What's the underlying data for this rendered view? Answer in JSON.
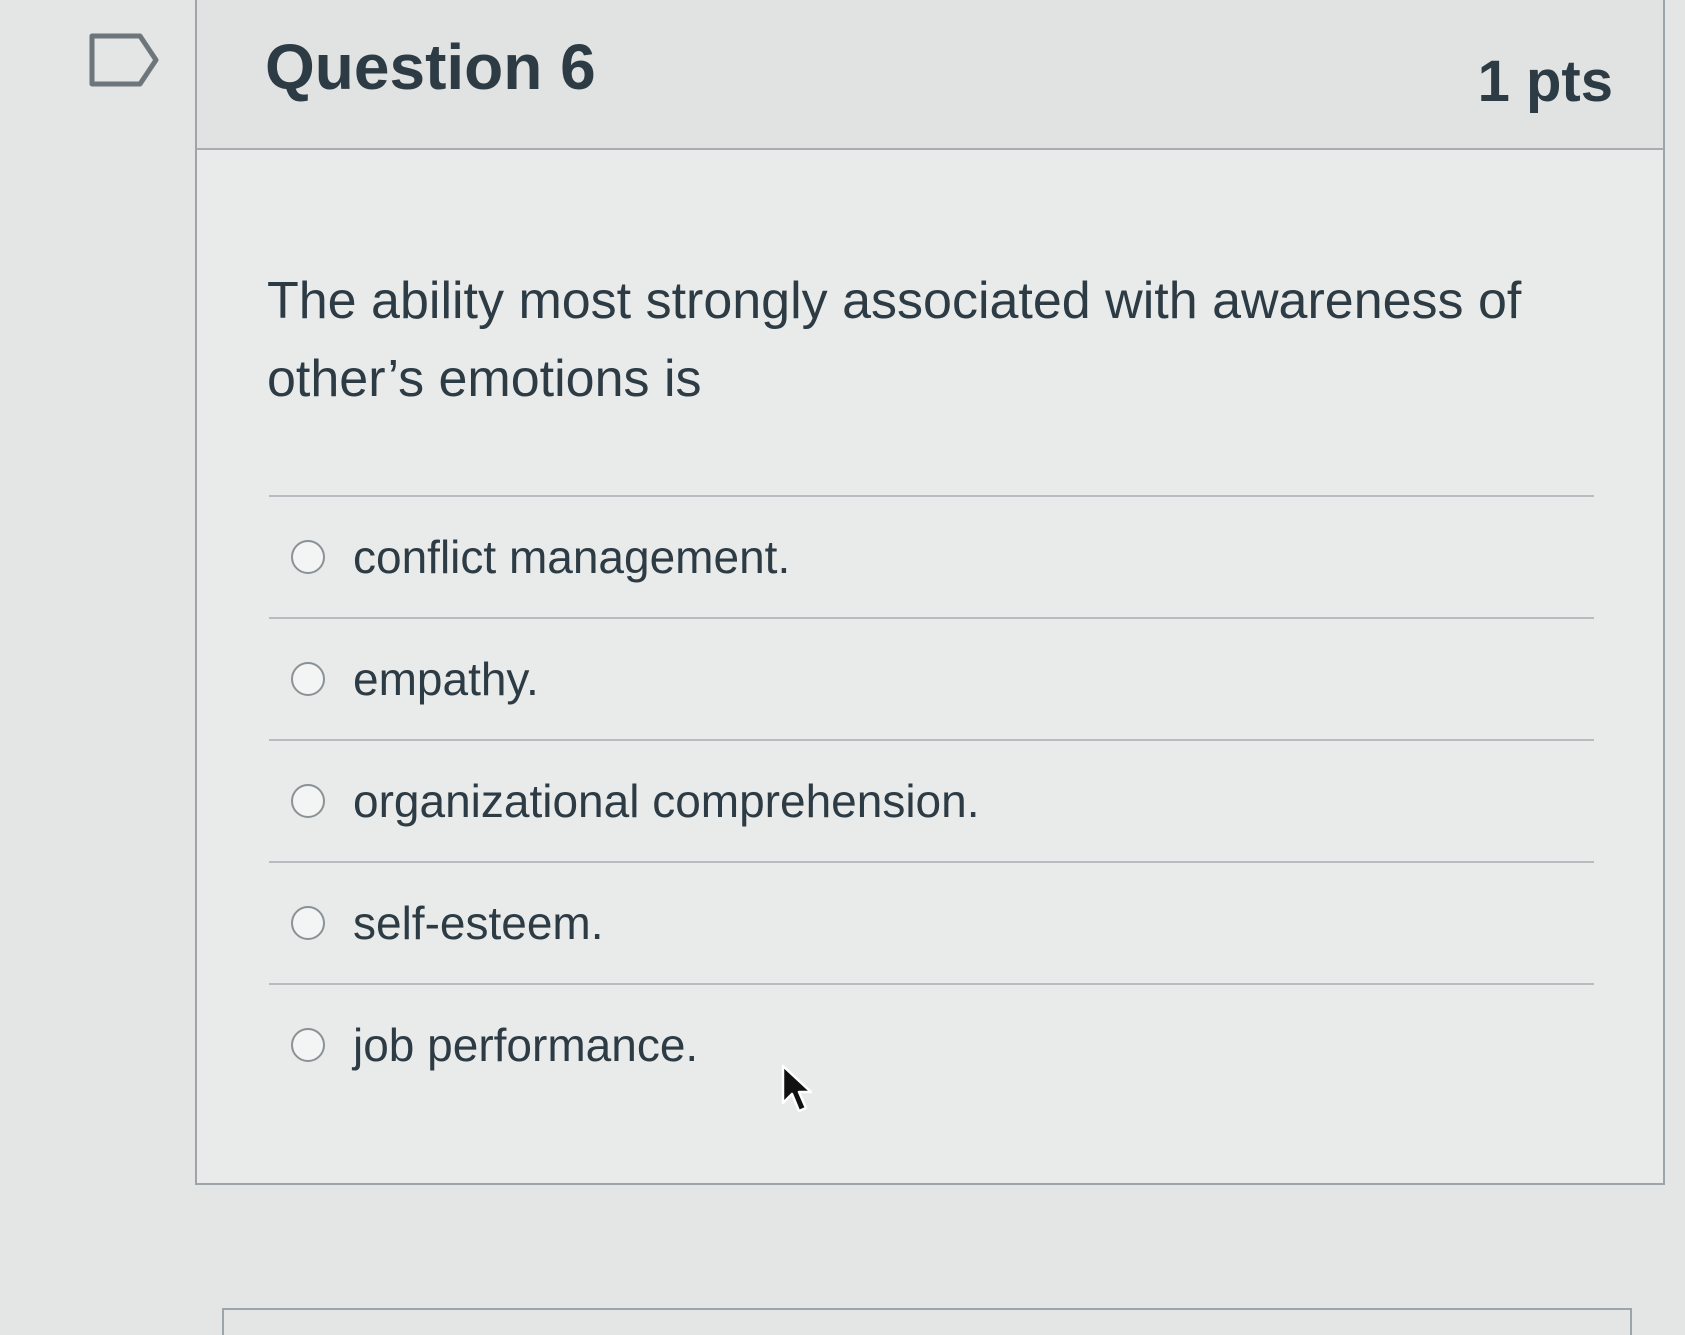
{
  "question": {
    "title": "Question 6",
    "points": "1 pts",
    "text": "The ability most strongly associated with awareness of other’s emotions is",
    "answers": [
      {
        "label": "conflict management."
      },
      {
        "label": "empathy."
      },
      {
        "label": "organizational comprehension."
      },
      {
        "label": "self-esteem."
      },
      {
        "label": "job performance."
      }
    ]
  },
  "icons": {
    "flag": "flag-outline-icon",
    "cursor": "mouse-pointer-icon"
  },
  "colors": {
    "text": "#2d3b45",
    "background": "#e4e6e5",
    "border": "#9ea5a8"
  }
}
